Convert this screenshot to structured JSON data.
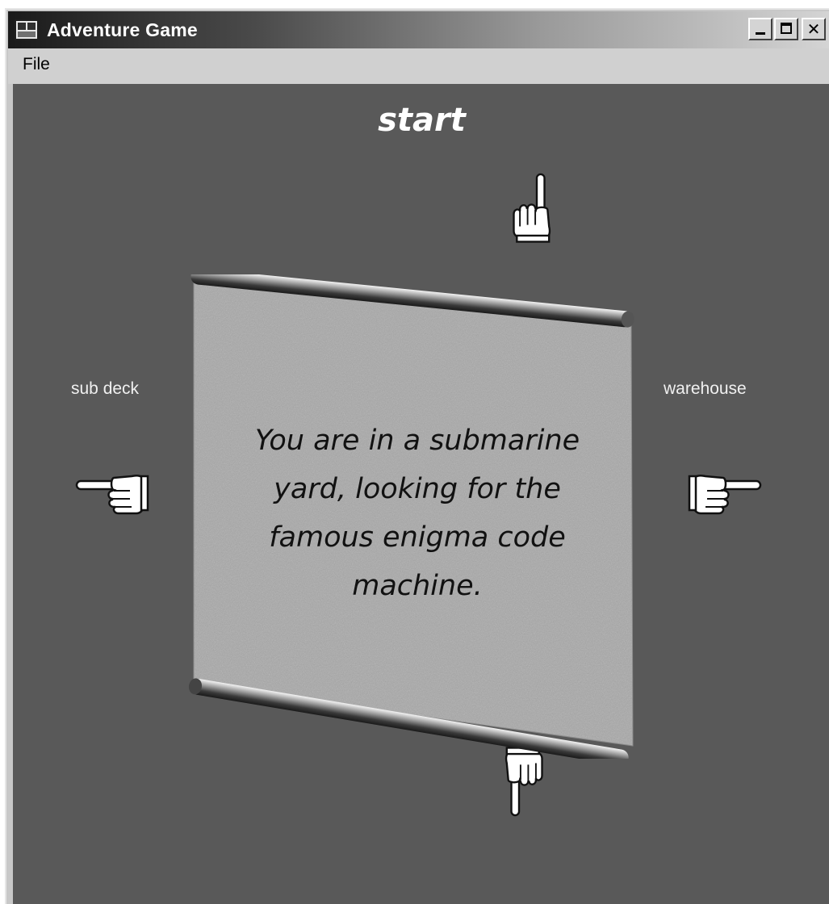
{
  "window": {
    "title": "Adventure Game"
  },
  "menu": {
    "items": [
      "File"
    ]
  },
  "room": {
    "name": "start",
    "description": "You are in a submarine yard, looking for the famous enigma code machine."
  },
  "exits": {
    "west_label": "sub deck",
    "east_label": "warehouse"
  },
  "icons": {
    "north": "pointing-hand-up-icon",
    "south": "pointing-hand-down-icon",
    "west": "pointing-hand-left-icon",
    "east": "pointing-hand-right-icon"
  },
  "colors": {
    "background": "#595959",
    "scroll": "#a8a8a8",
    "text": "#ffffff"
  }
}
